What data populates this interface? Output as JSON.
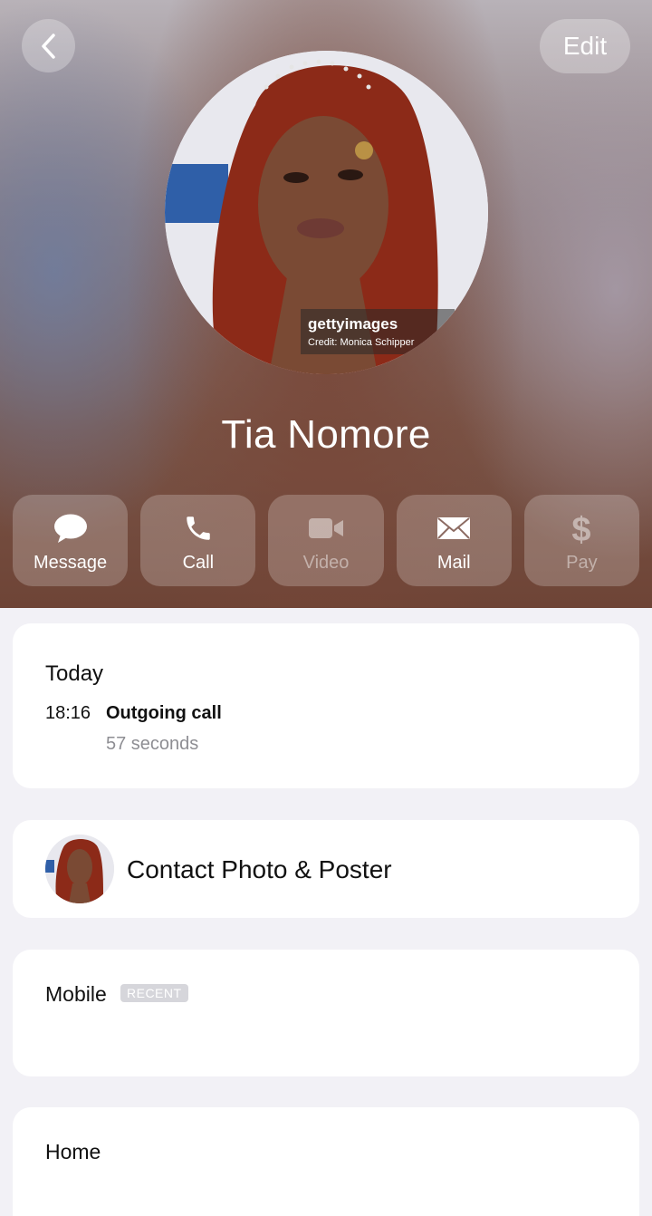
{
  "header": {
    "back_icon": "chevron-left-icon",
    "edit_label": "Edit",
    "contact_name": "Tia Nomore",
    "photo_watermark": "gettyimages",
    "photo_credit": "Credit: Monica Schipper"
  },
  "actions": [
    {
      "label": "Message",
      "icon": "message-bubble-icon",
      "enabled": true
    },
    {
      "label": "Call",
      "icon": "phone-icon",
      "enabled": true
    },
    {
      "label": "Video",
      "icon": "video-camera-icon",
      "enabled": false
    },
    {
      "label": "Mail",
      "icon": "envelope-icon",
      "enabled": true
    },
    {
      "label": "Pay",
      "icon": "dollar-icon",
      "enabled": false
    }
  ],
  "recents": {
    "day": "Today",
    "entries": [
      {
        "time": "18:16",
        "kind": "Outgoing call",
        "duration": "57 seconds"
      }
    ]
  },
  "poster": {
    "title": "Contact Photo & Poster"
  },
  "phones": [
    {
      "label": "Mobile",
      "badge": "RECENT"
    }
  ],
  "home": {
    "label": "Home"
  },
  "colors": {
    "page_bg": "#f2f1f6",
    "card_bg": "#ffffff",
    "secondary_text": "#8e8e93"
  }
}
